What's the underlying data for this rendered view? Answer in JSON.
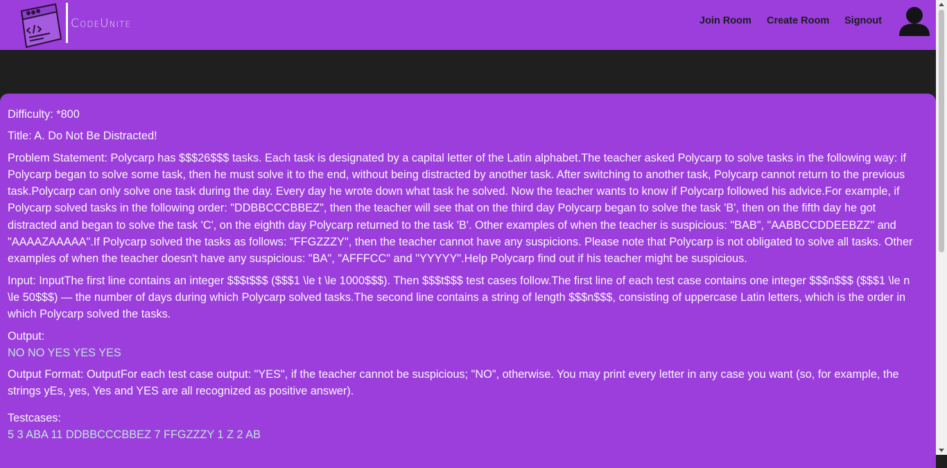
{
  "header": {
    "brand": "CodeUnite",
    "nav": {
      "join_room": "Join Room",
      "create_room": "Create Room",
      "signout": "Signout"
    }
  },
  "problem": {
    "difficulty": "Difficulty: *800",
    "title": "Title: A. Do Not Be Distracted!",
    "statement": "Problem Statement: Polycarp has $$$26$$$ tasks. Each task is designated by a capital letter of the Latin alphabet.The teacher asked Polycarp to solve tasks in the following way: if Polycarp began to solve some task, then he must solve it to the end, without being distracted by another task. After switching to another task, Polycarp cannot return to the previous task.Polycarp can only solve one task during the day. Every day he wrote down what task he solved. Now the teacher wants to know if Polycarp followed his advice.For example, if Polycarp solved tasks in the following order: \"DDBBCCCBBEZ\", then the teacher will see that on the third day Polycarp began to solve the task 'B', then on the fifth day he got distracted and began to solve the task 'C', on the eighth day Polycarp returned to the task 'B'. Other examples of when the teacher is suspicious: \"BAB\", \"AABBCCDDEEBZZ\" and \"AAAAZAAAAA\".If Polycarp solved the tasks as follows: \"FFGZZZY\", then the teacher cannot have any suspicions. Please note that Polycarp is not obligated to solve all tasks. Other examples of when the teacher doesn't have any suspicious: \"BA\", \"AFFFCC\" and \"YYYYY\".Help Polycarp find out if his teacher might be suspicious.",
    "input": "Input: InputThe first line contains an integer $$$t$$$ ($$$1 \\le t \\le 1000$$$). Then $$$t$$$ test cases follow.The first line of each test case contains one integer $$$n$$$ ($$$1 \\le n \\le 50$$$) — the number of days during which Polycarp solved tasks.The second line contains a string of length $$$n$$$, consisting of uppercase Latin letters, which is the order in which Polycarp solved the tasks.",
    "output_label": "Output:",
    "output_value": "NO NO YES YES YES",
    "output_format": "Output Format: OutputFor each test case output: \"YES\", if the teacher cannot be suspicious; \"NO\", otherwise. You may print every letter in any case you want (so, for example, the strings yEs, yes, Yes and YES are all recognized as positive answer).",
    "testcases_label": "Testcases:",
    "testcases_value": "5 3 ABA 11 DDBBCCCBBEZ 7 FFGZZZY 1 Z 2 AB"
  },
  "colors": {
    "primary": "#9b3edb",
    "dark_band": "#1f1f20",
    "accent_text": "#bfe5d8"
  }
}
